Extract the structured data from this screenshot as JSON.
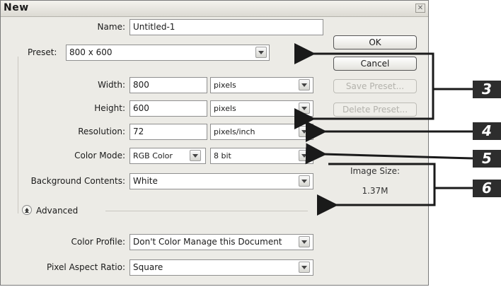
{
  "dialog": {
    "title": "New"
  },
  "fields": {
    "name_label": "Name:",
    "name_value": "Untitled-1",
    "preset_label": "Preset:",
    "preset_value": "800 x 600",
    "width_label": "Width:",
    "width_value": "800",
    "width_unit": "pixels",
    "height_label": "Height:",
    "height_value": "600",
    "height_unit": "pixels",
    "resolution_label": "Resolution:",
    "resolution_value": "72",
    "resolution_unit": "pixels/inch",
    "color_mode_label": "Color Mode:",
    "color_mode_value": "RGB Color",
    "bit_depth_value": "8 bit",
    "background_label": "Background Contents:",
    "background_value": "White",
    "advanced_label": "Advanced",
    "color_profile_label": "Color Profile:",
    "color_profile_value": "Don't Color Manage this Document",
    "pixel_aspect_label": "Pixel Aspect Ratio:",
    "pixel_aspect_value": "Square"
  },
  "buttons": {
    "ok": "OK",
    "cancel": "Cancel",
    "save_preset": "Save Preset...",
    "delete_preset": "Delete Preset..."
  },
  "info": {
    "image_size_label": "Image Size:",
    "image_size_value": "1.37M"
  },
  "callouts": {
    "c3": "3",
    "c4": "4",
    "c5": "5",
    "c6": "6"
  },
  "colors": {
    "dialog_bg": "#ecebe6",
    "callout_bg": "#2d2d2d"
  }
}
